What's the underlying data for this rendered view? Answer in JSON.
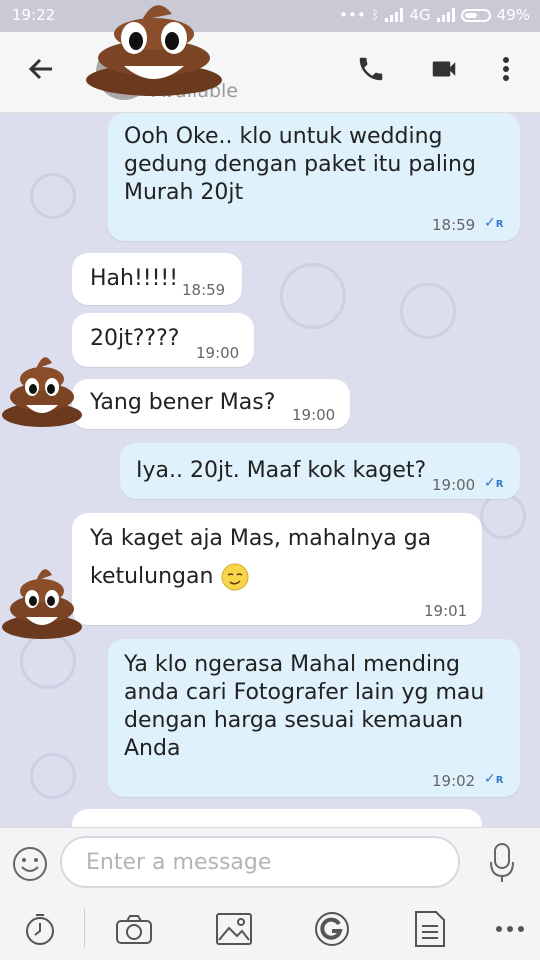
{
  "status_bar": {
    "time": "19:22",
    "network": "4G",
    "battery": "49%"
  },
  "header": {
    "contact_status": "Available"
  },
  "messages": [
    {
      "dir": "out",
      "lines": [
        "Ooh Oke.. klo untuk wedding",
        "gedung dengan paket itu paling",
        "Murah 20jt"
      ],
      "time": "18:59",
      "receipt": "R"
    },
    {
      "dir": "in",
      "lines": [
        "Hah!!!!!"
      ],
      "time": "18:59"
    },
    {
      "dir": "in",
      "lines": [
        "20jt????"
      ],
      "time": "19:00"
    },
    {
      "dir": "in",
      "lines": [
        "Yang bener Mas?"
      ],
      "time": "19:00"
    },
    {
      "dir": "out",
      "lines": [
        "Iya.. 20jt. Maaf kok kaget?"
      ],
      "time": "19:00",
      "receipt": "R"
    },
    {
      "dir": "in",
      "lines": [
        "Ya kaget aja Mas, mahalnya ga",
        "ketulungan"
      ],
      "time": "19:01"
    },
    {
      "dir": "out",
      "lines": [
        "Ya klo ngerasa Mahal mending",
        "anda cari Fotografer lain yg mau",
        "dengan harga sesuai kemauan",
        "Anda"
      ],
      "time": "19:02",
      "receipt": "R"
    }
  ],
  "input": {
    "placeholder": "Enter a message"
  },
  "colors": {
    "outgoing_bubble": "#dff1fb",
    "incoming_bubble": "#ffffff",
    "chat_background": "#dcdeee",
    "read_receipt": "#3a78c8"
  },
  "icons": [
    "back-arrow-icon",
    "phone-icon",
    "video-camera-icon",
    "more-vertical-icon",
    "emoji-icon",
    "microphone-icon",
    "timer-icon",
    "camera-icon",
    "gallery-icon",
    "g-icon",
    "document-icon",
    "more-horizontal-icon",
    "poop-emoji-icon"
  ]
}
